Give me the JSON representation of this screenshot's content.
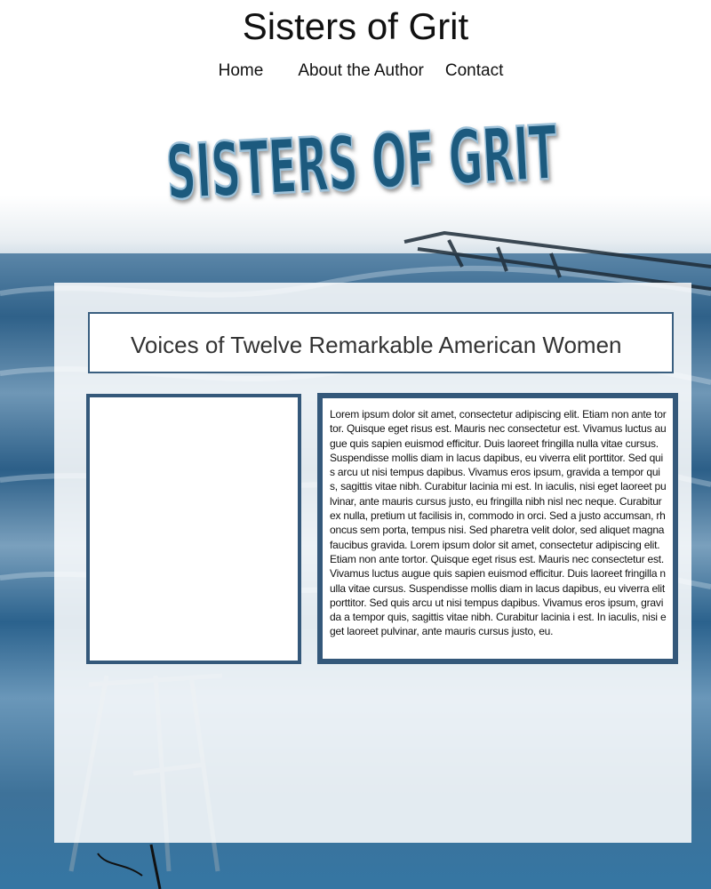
{
  "header": {
    "site_title": "Sisters of Grit",
    "nav": [
      {
        "label": "Home"
      },
      {
        "label": "About the Author"
      },
      {
        "label": "Contact"
      }
    ],
    "logo_text": "SISTERS OF GRIT"
  },
  "main": {
    "subtitle": "Voices of Twelve Remarkable American Women",
    "body_text": "Lorem ipsum dolor sit amet, consectetur adipiscing elit. Etiam non ante tortor. Quisque eget risus est. Mauris nec consectetur est. Vivamus luctus augue quis sapien euismod efficitur. Duis laoreet fringilla nulla vitae cursus. Suspendisse mollis diam in lacus dapibus, eu viverra elit porttitor. Sed quis arcu ut nisi tempus dapibus. Vivamus eros ipsum, gravida a tempor quis, sagittis vitae nibh. Curabitur lacinia mi est. In iaculis, nisi eget laoreet pulvinar, ante mauris cursus justo, eu fringilla nibh nisl nec neque. Curabitur ex nulla, pretium ut facilisis in, commodo in orci. Sed a justo accumsan, rhoncus sem porta, tempus nisi. Sed pharetra velit dolor, sed aliquet magna faucibus gravida. Lorem ipsum dolor sit amet, consectetur adipiscing elit. Etiam non ante tortor. Quisque eget risus est. Mauris nec consectetur est. Vivamus luctus augue quis sapien euismod efficitur. Duis laoreet fringilla nulla vitae cursus. Suspendisse mollis diam in lacus dapibus, eu viverra elit porttitor. Sed quis arcu ut nisi tempus dapibus. Vivamus eros ipsum, gravida a tempor quis, sagittis vitae nibh. Curabitur lacinia i est. In iaculis, nisi eget laoreet pulvinar, ante mauris cursus justo, eu."
  },
  "colors": {
    "accent": "#34587a",
    "logo_fill": "#1f5a7e",
    "ocean": "#2f6189"
  },
  "icons": {
    "background": "biplane-over-ocean-illustration"
  }
}
